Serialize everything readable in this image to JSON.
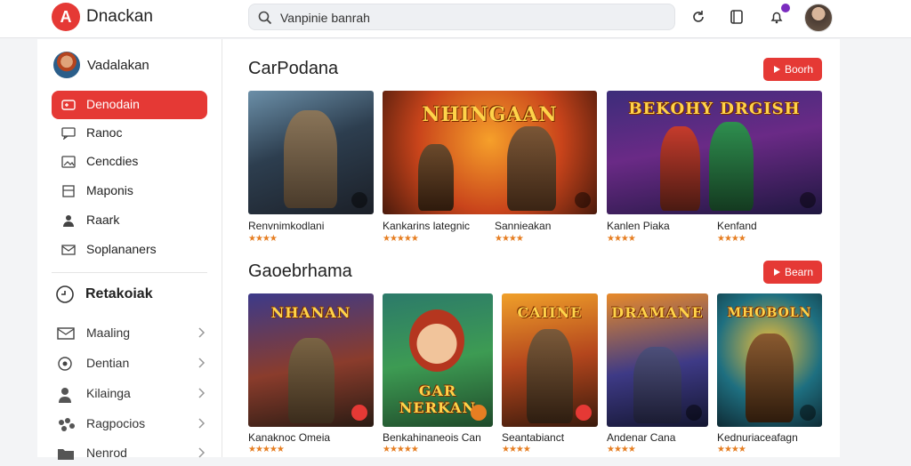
{
  "app": {
    "brand": "Dnackan",
    "logo_letter": "A"
  },
  "search": {
    "value": "Vanpinie banrah",
    "placeholder": ""
  },
  "user": {
    "name": "Vadalakan"
  },
  "sidebar": {
    "items": [
      {
        "label": "Denodain",
        "icon": "gamepad-icon",
        "active": true
      },
      {
        "label": "Ranoc",
        "icon": "chat-icon",
        "active": false
      },
      {
        "label": "Cencdies",
        "icon": "image-icon",
        "active": false
      },
      {
        "label": "Maponis",
        "icon": "book-icon",
        "active": false
      },
      {
        "label": "Raark",
        "icon": "person-icon",
        "active": false
      },
      {
        "label": "Soplananers",
        "icon": "mail-icon",
        "active": false
      }
    ],
    "section_title": "Retakoiak",
    "sub_items": [
      {
        "label": "Maaling",
        "icon": "mail-icon"
      },
      {
        "label": "Dentian",
        "icon": "badge-icon"
      },
      {
        "label": "Kilainga",
        "icon": "user-icon"
      },
      {
        "label": "Ragpocios",
        "icon": "group-icon"
      },
      {
        "label": "Nenrod",
        "icon": "folder-icon"
      }
    ]
  },
  "sections": [
    {
      "title": "CarPodana",
      "button": "Boorh",
      "cards": [
        {
          "name": "Renvnimkodlani",
          "stars": "★★★★",
          "thumb_title": ""
        },
        {
          "name": "Kankarins lategnic",
          "stars": "★★★★★",
          "thumb_title": "NHINGAAN"
        },
        {
          "name": "Sannieakan",
          "stars": "★★★★",
          "thumb_title": ""
        },
        {
          "name": "Kanlen Piaka",
          "stars": "★★★★",
          "thumb_title": "BEKOHY DRGISH"
        },
        {
          "name": "Kenfand",
          "stars": "★★★★",
          "thumb_title": ""
        }
      ]
    },
    {
      "title": "Gaoebrhama",
      "button": "Bearn",
      "cards": [
        {
          "name": "Kanaknoc Omeia",
          "stars": "★★★★★",
          "thumb_title": "NHANAN"
        },
        {
          "name": "Benkahinaneois Can",
          "stars": "★★★★★",
          "thumb_title": "GAR NERKAN"
        },
        {
          "name": "Seantabianct",
          "stars": "★★★★",
          "thumb_title": "CAIINE"
        },
        {
          "name": "Andenar Cana",
          "stars": "★★★★",
          "thumb_title": "DRAMANE"
        },
        {
          "name": "Kednuriaceafagn",
          "stars": "★★★★",
          "thumb_title": "MHOBOLN"
        }
      ]
    }
  ],
  "colors": {
    "accent": "#e53935",
    "star": "#e67e22"
  }
}
